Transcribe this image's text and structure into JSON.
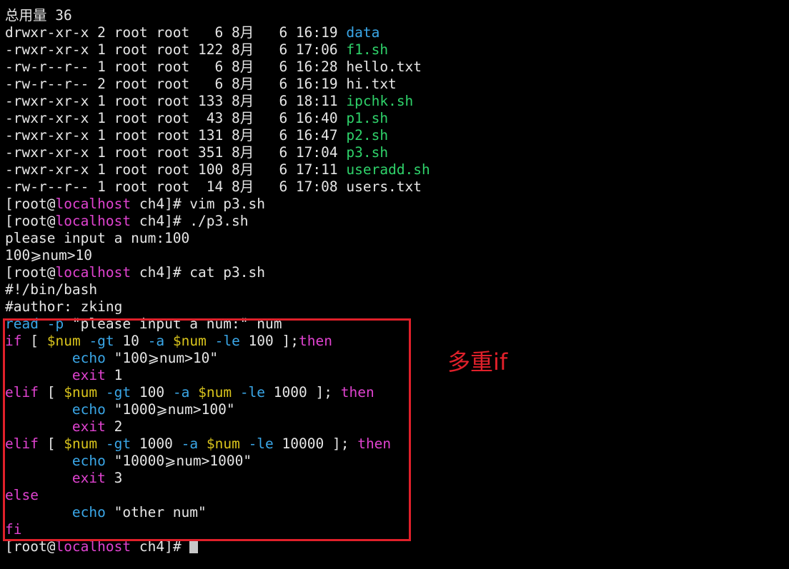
{
  "colors": {
    "background": "#000000",
    "text": "#e6e6e6",
    "directory": "#3aa7e8",
    "executable": "#2fd26a",
    "hostname_keyword": "#e043d0",
    "command_option": "#3aa7e8",
    "variable": "#d9c41c",
    "highlight": "#e0202a"
  },
  "annotation": "多重if",
  "lines": [
    [
      {
        "t": "总用量 36",
        "c": "txt"
      }
    ],
    [
      {
        "t": "drwxr-xr-x 2 root root   6 8月   6 16:19 ",
        "c": "txt"
      },
      {
        "t": "data",
        "c": "dir"
      }
    ],
    [
      {
        "t": "-rwxr-xr-x 1 root root 122 8月   6 17:06 ",
        "c": "txt"
      },
      {
        "t": "f1.sh",
        "c": "exe"
      }
    ],
    [
      {
        "t": "-rw-r--r-- 1 root root   6 8月   6 16:28 hello.txt",
        "c": "txt"
      }
    ],
    [
      {
        "t": "-rw-r--r-- 2 root root   6 8月   6 16:19 hi.txt",
        "c": "txt"
      }
    ],
    [
      {
        "t": "-rwxr-xr-x 1 root root 133 8月   6 18:11 ",
        "c": "txt"
      },
      {
        "t": "ipchk.sh",
        "c": "exe"
      }
    ],
    [
      {
        "t": "-rwxr-xr-x 1 root root  43 8月   6 16:40 ",
        "c": "txt"
      },
      {
        "t": "p1.sh",
        "c": "exe"
      }
    ],
    [
      {
        "t": "-rwxr-xr-x 1 root root 131 8月   6 16:47 ",
        "c": "txt"
      },
      {
        "t": "p2.sh",
        "c": "exe"
      }
    ],
    [
      {
        "t": "-rwxr-xr-x 1 root root 351 8月   6 17:04 ",
        "c": "txt"
      },
      {
        "t": "p3.sh",
        "c": "exe"
      }
    ],
    [
      {
        "t": "-rwxr-xr-x 1 root root 100 8月   6 17:11 ",
        "c": "txt"
      },
      {
        "t": "useradd.sh",
        "c": "exe"
      }
    ],
    [
      {
        "t": "-rw-r--r-- 1 root root  14 8月   6 17:08 users.txt",
        "c": "txt"
      }
    ],
    [
      {
        "t": "[root@",
        "c": "txt"
      },
      {
        "t": "localhost",
        "c": "host"
      },
      {
        "t": " ch4]# vim p3.sh",
        "c": "txt"
      }
    ],
    [
      {
        "t": "[root@",
        "c": "txt"
      },
      {
        "t": "localhost",
        "c": "host"
      },
      {
        "t": " ch4]# ./p3.sh",
        "c": "txt"
      }
    ],
    [
      {
        "t": "please input a num:100",
        "c": "txt"
      }
    ],
    [
      {
        "t": "100⩾num>10",
        "c": "txt"
      }
    ],
    [
      {
        "t": "[root@",
        "c": "txt"
      },
      {
        "t": "localhost",
        "c": "host"
      },
      {
        "t": " ch4]# cat p3.sh",
        "c": "txt"
      }
    ],
    [
      {
        "t": "#!/bin/bash",
        "c": "txt"
      }
    ],
    [
      {
        "t": "#author: zking",
        "c": "txt"
      }
    ],
    [
      {
        "t": "read",
        "c": "cmd"
      },
      {
        "t": " ",
        "c": "txt"
      },
      {
        "t": "-p",
        "c": "opt"
      },
      {
        "t": " \"please input a num:\" num",
        "c": "txt"
      }
    ],
    [
      {
        "t": "if",
        "c": "kw"
      },
      {
        "t": " [ ",
        "c": "txt"
      },
      {
        "t": "$num",
        "c": "var"
      },
      {
        "t": " ",
        "c": "txt"
      },
      {
        "t": "-gt",
        "c": "opt"
      },
      {
        "t": " 10 ",
        "c": "txt"
      },
      {
        "t": "-a",
        "c": "opt"
      },
      {
        "t": " ",
        "c": "txt"
      },
      {
        "t": "$num",
        "c": "var"
      },
      {
        "t": " ",
        "c": "txt"
      },
      {
        "t": "-le",
        "c": "opt"
      },
      {
        "t": " 100 ];",
        "c": "txt"
      },
      {
        "t": "then",
        "c": "kw"
      }
    ],
    [
      {
        "t": "        ",
        "c": "txt"
      },
      {
        "t": "echo",
        "c": "cmd"
      },
      {
        "t": " \"100⩾num>10\"",
        "c": "txt"
      }
    ],
    [
      {
        "t": "        ",
        "c": "txt"
      },
      {
        "t": "exit",
        "c": "kw"
      },
      {
        "t": " 1",
        "c": "txt"
      }
    ],
    [
      {
        "t": "elif",
        "c": "kw"
      },
      {
        "t": " [ ",
        "c": "txt"
      },
      {
        "t": "$num",
        "c": "var"
      },
      {
        "t": " ",
        "c": "txt"
      },
      {
        "t": "-gt",
        "c": "opt"
      },
      {
        "t": " 100 ",
        "c": "txt"
      },
      {
        "t": "-a",
        "c": "opt"
      },
      {
        "t": " ",
        "c": "txt"
      },
      {
        "t": "$num",
        "c": "var"
      },
      {
        "t": " ",
        "c": "txt"
      },
      {
        "t": "-le",
        "c": "opt"
      },
      {
        "t": " 1000 ]; ",
        "c": "txt"
      },
      {
        "t": "then",
        "c": "kw"
      }
    ],
    [
      {
        "t": "        ",
        "c": "txt"
      },
      {
        "t": "echo",
        "c": "cmd"
      },
      {
        "t": " \"1000⩾num>100\"",
        "c": "txt"
      }
    ],
    [
      {
        "t": "        ",
        "c": "txt"
      },
      {
        "t": "exit",
        "c": "kw"
      },
      {
        "t": " 2",
        "c": "txt"
      }
    ],
    [
      {
        "t": "elif",
        "c": "kw"
      },
      {
        "t": " [ ",
        "c": "txt"
      },
      {
        "t": "$num",
        "c": "var"
      },
      {
        "t": " ",
        "c": "txt"
      },
      {
        "t": "-gt",
        "c": "opt"
      },
      {
        "t": " 1000 ",
        "c": "txt"
      },
      {
        "t": "-a",
        "c": "opt"
      },
      {
        "t": " ",
        "c": "txt"
      },
      {
        "t": "$num",
        "c": "var"
      },
      {
        "t": " ",
        "c": "txt"
      },
      {
        "t": "-le",
        "c": "opt"
      },
      {
        "t": " 10000 ]; ",
        "c": "txt"
      },
      {
        "t": "then",
        "c": "kw"
      }
    ],
    [
      {
        "t": "        ",
        "c": "txt"
      },
      {
        "t": "echo",
        "c": "cmd"
      },
      {
        "t": " \"10000⩾num>1000\"",
        "c": "txt"
      }
    ],
    [
      {
        "t": "        ",
        "c": "txt"
      },
      {
        "t": "exit",
        "c": "kw"
      },
      {
        "t": " 3",
        "c": "txt"
      }
    ],
    [
      {
        "t": "else",
        "c": "kw"
      }
    ],
    [
      {
        "t": "        ",
        "c": "txt"
      },
      {
        "t": "echo",
        "c": "cmd"
      },
      {
        "t": " \"other num\"",
        "c": "txt"
      }
    ],
    [
      {
        "t": "fi",
        "c": "kw"
      }
    ],
    [
      {
        "t": "[root@",
        "c": "txt"
      },
      {
        "t": "localhost",
        "c": "host"
      },
      {
        "t": " ch4]# ",
        "c": "txt"
      }
    ]
  ]
}
